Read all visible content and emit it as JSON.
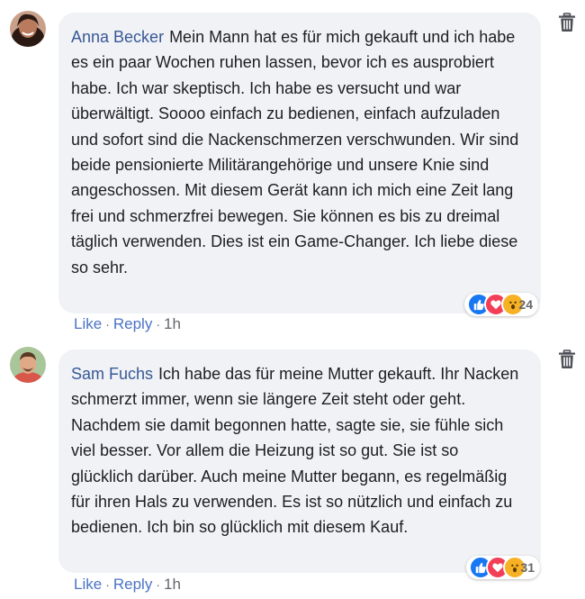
{
  "comments": [
    {
      "author": "Anna Becker",
      "text": "Mein Mann hat es für mich gekauft und ich habe es ein paar Wochen ruhen lassen, bevor ich es ausprobiert habe. Ich war skeptisch. Ich habe es versucht und war überwältigt. Soooo einfach zu bedienen, einfach aufzuladen und sofort sind die Nackenschmerzen verschwunden. Wir sind beide pensionierte Militärangehörige und unsere Knie sind angeschossen. Mit diesem Gerät kann ich mich eine Zeit lang frei und schmerzfrei bewegen. Sie können es bis zu dreimal täglich verwenden. Dies ist ein Game-Changer. Ich liebe diese so sehr.",
      "reaction_count": "24",
      "like_label": "Like",
      "reply_label": "Reply",
      "time": "1h",
      "separator": "·",
      "avatar_icon": "female-profile-photo",
      "reaction_icons": [
        "like-icon",
        "love-icon",
        "wow-icon"
      ]
    },
    {
      "author": "Sam Fuchs",
      "text": "Ich habe das für meine Mutter gekauft. Ihr Nacken schmerzt immer, wenn sie längere Zeit steht oder geht. Nachdem sie damit begonnen hatte, sagte sie, sie fühle sich viel besser. Vor allem die Heizung ist so gut. Sie ist so glücklich darüber. Auch meine Mutter begann, es regelmäßig für ihren Hals zu verwenden. Es ist so nützlich und einfach zu bedienen. Ich bin so glücklich mit diesem Kauf.",
      "reaction_count": "31",
      "like_label": "Like",
      "reply_label": "Reply",
      "time": "1h",
      "separator": "·",
      "avatar_icon": "male-profile-photo",
      "reaction_icons": [
        "like-icon",
        "love-icon",
        "wow-icon"
      ]
    }
  ],
  "colors": {
    "author": "#385898",
    "link": "#4b73c4",
    "bubble": "#f0f2f5",
    "like": "#1877f2",
    "love": "#f33e58",
    "wow": "#f7b125"
  },
  "delete_icon": "trash-icon"
}
